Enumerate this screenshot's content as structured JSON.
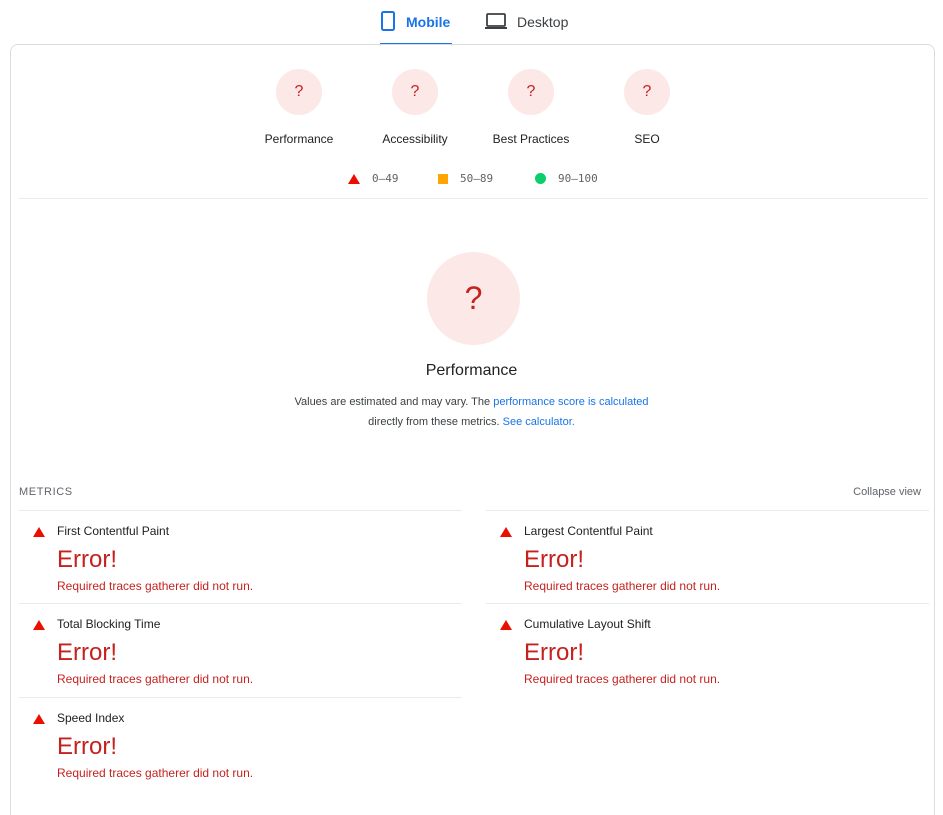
{
  "tabs": [
    {
      "label": "Mobile",
      "icon": "phone-icon",
      "active": true
    },
    {
      "label": "Desktop",
      "icon": "laptop-icon",
      "active": false
    }
  ],
  "categories": [
    {
      "score": "?",
      "label": "Performance"
    },
    {
      "score": "?",
      "label": "Accessibility"
    },
    {
      "score": "?",
      "label": "Best Practices"
    },
    {
      "score": "?",
      "label": "SEO"
    }
  ],
  "legend": [
    {
      "range": "0–49",
      "shape": "triangle",
      "color": "#eb0f00"
    },
    {
      "range": "50–89",
      "shape": "square",
      "color": "#ffa400"
    },
    {
      "range": "90–100",
      "shape": "circle",
      "color": "#0cce6b"
    }
  ],
  "performance": {
    "score": "?",
    "title": "Performance",
    "desc_1": "Values are estimated and may vary. The ",
    "desc_link_1": "performance score is calculated",
    "desc_2": "directly from these metrics. ",
    "desc_link_2": "See calculator."
  },
  "metrics_section": {
    "heading": "METRICS",
    "collapse_label": "Collapse view"
  },
  "metrics": [
    {
      "name": "First Contentful Paint",
      "value": "Error!",
      "error": "Required traces gatherer did not run."
    },
    {
      "name": "Largest Contentful Paint",
      "value": "Error!",
      "error": "Required traces gatherer did not run."
    },
    {
      "name": "Total Blocking Time",
      "value": "Error!",
      "error": "Required traces gatherer did not run."
    },
    {
      "name": "Cumulative Layout Shift",
      "value": "Error!",
      "error": "Required traces gatherer did not run."
    },
    {
      "name": "Speed Index",
      "value": "Error!",
      "error": "Required traces gatherer did not run."
    }
  ],
  "colors": {
    "accent": "#1a73e8",
    "fail": "#c5221f",
    "fail_bg": "#fce8e6"
  }
}
